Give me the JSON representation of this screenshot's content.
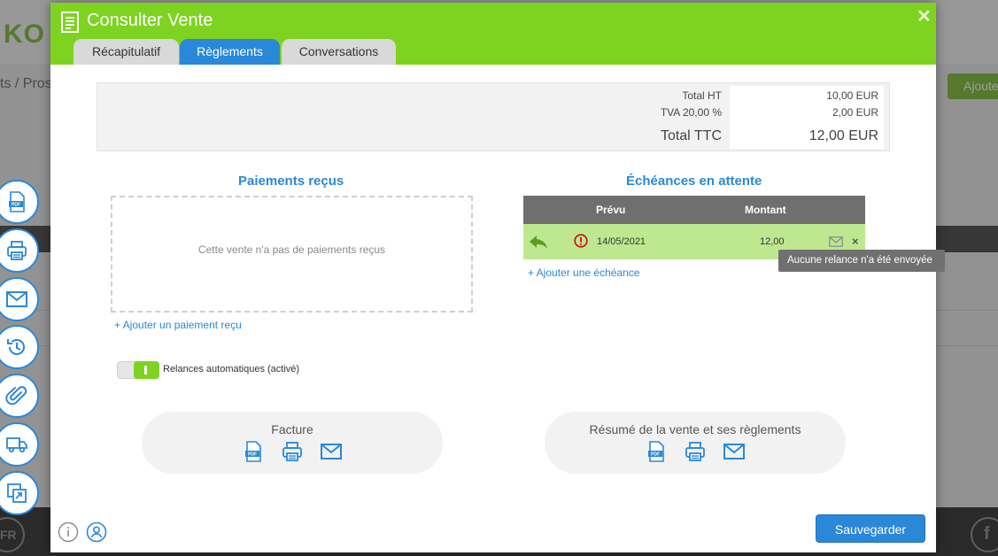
{
  "background": {
    "logo_text": "KO",
    "breadcrumb": "ts / Pros",
    "add_button_label": "Ajoute",
    "footer_left_badge": "FR",
    "footer_right_badge": "f",
    "side_buttons": [
      {
        "icon": "pdf-icon"
      },
      {
        "icon": "printer-icon"
      },
      {
        "icon": "mail-icon"
      },
      {
        "icon": "history-icon"
      },
      {
        "icon": "paperclip-icon"
      },
      {
        "icon": "truck-icon"
      },
      {
        "icon": "convert-icon"
      }
    ]
  },
  "modal": {
    "title": "Consulter Vente",
    "close_glyph": "✕",
    "tabs": [
      {
        "label": "Récapitulatif",
        "active": false
      },
      {
        "label": "Règlements",
        "active": true
      },
      {
        "label": "Conversations",
        "active": false
      }
    ],
    "totals": {
      "ht_label": "Total HT",
      "ht_value": "10,00 EUR",
      "tva_label": "TVA 20,00 %",
      "tva_value": "2,00 EUR",
      "ttc_label": "Total TTC",
      "ttc_value": "12,00 EUR"
    },
    "payments": {
      "title": "Paiements reçus",
      "empty_text": "Cette vente n'a pas de paiements reçus",
      "add_link": "+ Ajouter un paiement reçu"
    },
    "echeances": {
      "title": "Échéances en attente",
      "col_prevu": "Prévu",
      "col_montant": "Montant",
      "rows": [
        {
          "date": "14/05/2021",
          "amount": "12,00",
          "status_icon": "warning-icon"
        }
      ],
      "add_link": "+ Ajouter une échéance",
      "tooltip": "Aucune relance n'a été envoyée"
    },
    "relances": {
      "label": "Relances automatiques (activé)",
      "enabled": true
    },
    "cards": [
      {
        "title": "Facture",
        "icons": [
          "pdf-icon",
          "printer-icon",
          "mail-icon"
        ]
      },
      {
        "title": "Résumé de la vente et ses règlements",
        "icons": [
          "pdf-icon",
          "printer-icon",
          "mail-icon"
        ]
      }
    ],
    "save_label": "Sauvegarder",
    "colors": {
      "header_green": "#7ed321",
      "accent_blue": "#2a88d8",
      "row_green": "#bde88f"
    }
  }
}
